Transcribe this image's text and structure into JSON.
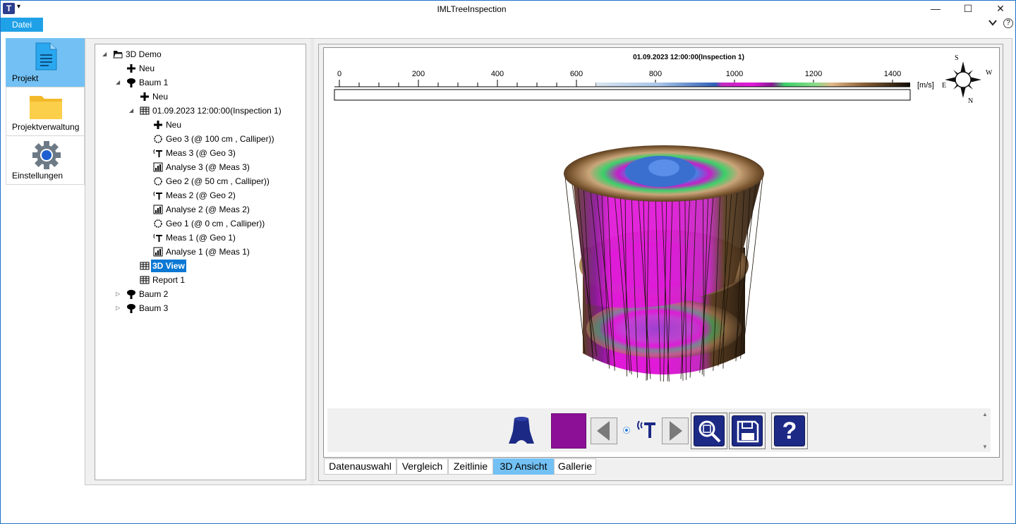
{
  "window": {
    "title": "IMLTreeInspection",
    "app_icon_letter": "T",
    "minimize_glyph": "—",
    "maximize_glyph": "☐",
    "close_glyph": "✕"
  },
  "menu": {
    "file_label": "Datei",
    "collapse_glyph": "⌄",
    "help_glyph": "?"
  },
  "nav": {
    "items": [
      {
        "label": "Projekt",
        "icon": "document-icon",
        "active": true
      },
      {
        "label": "Projektverwaltung",
        "icon": "folder-icon",
        "active": false
      },
      {
        "label": "Einstellungen",
        "icon": "gear-icon",
        "active": false
      }
    ]
  },
  "tree": {
    "nodes": [
      {
        "label": "3D Demo",
        "icon": "folder-icon",
        "expander": "expanded"
      },
      {
        "label": "Neu",
        "icon": "plus-icon",
        "expander": "none"
      },
      {
        "label": "Baum 1",
        "icon": "tree-icon",
        "expander": "expanded"
      },
      {
        "label": "Neu",
        "icon": "plus-icon",
        "expander": "none"
      },
      {
        "label": "01.09.2023 12:00:00(Inspection 1)",
        "icon": "grid-icon",
        "expander": "expanded"
      },
      {
        "label": "Neu",
        "icon": "plus-icon",
        "expander": "none"
      },
      {
        "label": "Geo 3 (@ 100 cm , Calliper))",
        "icon": "geometry-icon",
        "expander": "none"
      },
      {
        "label": "Meas 3 (@ Geo 3)",
        "icon": "sensor-icon",
        "expander": "none"
      },
      {
        "label": "Analyse 3 (@ Meas 3)",
        "icon": "chart-icon",
        "expander": "none"
      },
      {
        "label": "Geo 2 (@ 50 cm , Calliper))",
        "icon": "geometry-icon",
        "expander": "none"
      },
      {
        "label": "Meas 2 (@ Geo 2)",
        "icon": "sensor-icon",
        "expander": "none"
      },
      {
        "label": "Analyse 2 (@ Meas 2)",
        "icon": "chart-icon",
        "expander": "none"
      },
      {
        "label": "Geo 1 (@ 0 cm , Calliper))",
        "icon": "geometry-icon",
        "expander": "none"
      },
      {
        "label": "Meas 1 (@ Geo 1)",
        "icon": "sensor-icon",
        "expander": "none"
      },
      {
        "label": "Analyse 1 (@ Meas 1)",
        "icon": "chart-icon",
        "expander": "none"
      },
      {
        "label": "3D View",
        "icon": "grid-icon",
        "expander": "none",
        "selected": true
      },
      {
        "label": "Report 1",
        "icon": "grid-icon",
        "expander": "none"
      },
      {
        "label": "Baum 2",
        "icon": "tree-icon",
        "expander": "collapsed"
      },
      {
        "label": "Baum 3",
        "icon": "tree-icon",
        "expander": "collapsed"
      }
    ]
  },
  "viewer": {
    "scale_title": "01.09.2023 12:00:00(Inspection 1)",
    "scale_ticks": [
      "0",
      "200",
      "400",
      "600",
      "800",
      "1000",
      "1200",
      "1400"
    ],
    "scale_unit": "[m/s]",
    "compass": {
      "top": "S",
      "left": "E",
      "right": "W",
      "bottom": "N"
    },
    "colors": {
      "brown_dark": "#2b1d10",
      "brown_mid": "#8a6238",
      "tan": "#c9a06e",
      "magenta": "#e01ad8",
      "purple": "#8a1a96",
      "green": "#3bd06a",
      "blue": "#3a6fd0",
      "light_blue": "#a9c6e8",
      "accent_purple": "#8b1096",
      "nav_active": "#73c1f4",
      "button_navy": "#1c2a86"
    }
  },
  "toolbar": {
    "buttons": [
      {
        "name": "stem-view-icon"
      },
      {
        "name": "color-swatch"
      },
      {
        "name": "prev-arrow-icon"
      },
      {
        "name": "sensor-icon"
      },
      {
        "name": "next-arrow-icon"
      },
      {
        "name": "zoom-icon"
      },
      {
        "name": "save-icon"
      },
      {
        "name": "help-icon",
        "glyph": "?"
      }
    ]
  },
  "tabs": [
    {
      "label": "Datenauswahl",
      "active": false
    },
    {
      "label": "Vergleich",
      "active": false
    },
    {
      "label": "Zeitlinie",
      "active": false
    },
    {
      "label": "3D Ansicht",
      "active": true
    },
    {
      "label": "Gallerie",
      "active": false
    }
  ]
}
